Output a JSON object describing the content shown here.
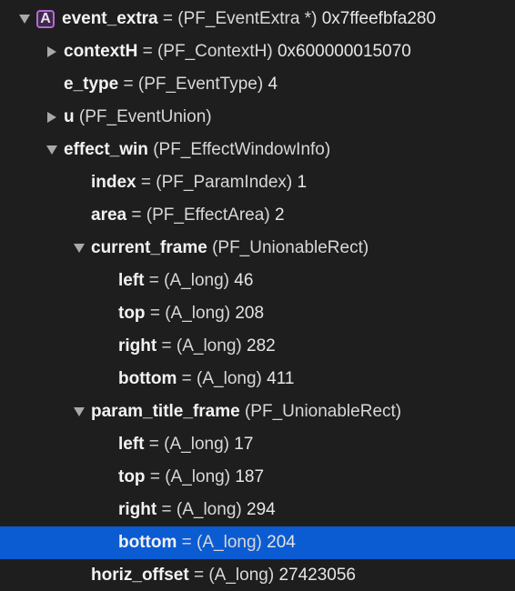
{
  "colors": {
    "background": "#1e1e1e",
    "selection": "#0b5bd3",
    "badge_border": "#b56ad6",
    "text": "#e6e6e6",
    "disclosure": "#a9a9a9"
  },
  "rows": [
    {
      "id": "event_extra",
      "indent": 0,
      "disclosure": "expanded",
      "badge": "A",
      "name": "event_extra",
      "eq": "=",
      "type": "(PF_EventExtra *)",
      "value": "0x7ffeefbfa280",
      "selected": false
    },
    {
      "id": "contextH",
      "indent": 1,
      "disclosure": "collapsed",
      "name": "contextH",
      "eq": "=",
      "type": "(PF_ContextH)",
      "value": "0x600000015070",
      "selected": false
    },
    {
      "id": "e_type",
      "indent": 1,
      "disclosure": "none",
      "name": "e_type",
      "eq": "=",
      "type": "(PF_EventType)",
      "value": "4",
      "selected": false
    },
    {
      "id": "u",
      "indent": 1,
      "disclosure": "collapsed",
      "name": "u",
      "eq": "",
      "type": "(PF_EventUnion)",
      "value": "",
      "selected": false
    },
    {
      "id": "effect_win",
      "indent": 1,
      "disclosure": "expanded",
      "name": "effect_win",
      "eq": "",
      "type": "(PF_EffectWindowInfo)",
      "value": "",
      "selected": false
    },
    {
      "id": "index",
      "indent": 2,
      "disclosure": "none",
      "name": "index",
      "eq": "=",
      "type": "(PF_ParamIndex)",
      "value": "1",
      "selected": false
    },
    {
      "id": "area",
      "indent": 2,
      "disclosure": "none",
      "name": "area",
      "eq": "=",
      "type": "(PF_EffectArea)",
      "value": "2",
      "selected": false
    },
    {
      "id": "current_frame",
      "indent": 2,
      "disclosure": "expanded",
      "name": "current_frame",
      "eq": "",
      "type": "(PF_UnionableRect)",
      "value": "",
      "selected": false
    },
    {
      "id": "cf_left",
      "indent": 3,
      "disclosure": "none",
      "name": "left",
      "eq": "=",
      "type": "(A_long)",
      "value": "46",
      "selected": false
    },
    {
      "id": "cf_top",
      "indent": 3,
      "disclosure": "none",
      "name": "top",
      "eq": "=",
      "type": "(A_long)",
      "value": "208",
      "selected": false
    },
    {
      "id": "cf_right",
      "indent": 3,
      "disclosure": "none",
      "name": "right",
      "eq": "=",
      "type": "(A_long)",
      "value": "282",
      "selected": false
    },
    {
      "id": "cf_bottom",
      "indent": 3,
      "disclosure": "none",
      "name": "bottom",
      "eq": "=",
      "type": "(A_long)",
      "value": "411",
      "selected": false
    },
    {
      "id": "param_title_frame",
      "indent": 2,
      "disclosure": "expanded",
      "name": "param_title_frame",
      "eq": "",
      "type": "(PF_UnionableRect)",
      "value": "",
      "selected": false
    },
    {
      "id": "ptf_left",
      "indent": 3,
      "disclosure": "none",
      "name": "left",
      "eq": "=",
      "type": "(A_long)",
      "value": "17",
      "selected": false
    },
    {
      "id": "ptf_top",
      "indent": 3,
      "disclosure": "none",
      "name": "top",
      "eq": "=",
      "type": "(A_long)",
      "value": "187",
      "selected": false
    },
    {
      "id": "ptf_right",
      "indent": 3,
      "disclosure": "none",
      "name": "right",
      "eq": "=",
      "type": "(A_long)",
      "value": "294",
      "selected": false
    },
    {
      "id": "ptf_bottom",
      "indent": 3,
      "disclosure": "none",
      "name": "bottom",
      "eq": "=",
      "type": "(A_long)",
      "value": "204",
      "selected": true
    },
    {
      "id": "horiz_offset",
      "indent": 2,
      "disclosure": "none",
      "name": "horiz_offset",
      "eq": "=",
      "type": "(A_long)",
      "value": "27423056",
      "selected": false
    }
  ]
}
